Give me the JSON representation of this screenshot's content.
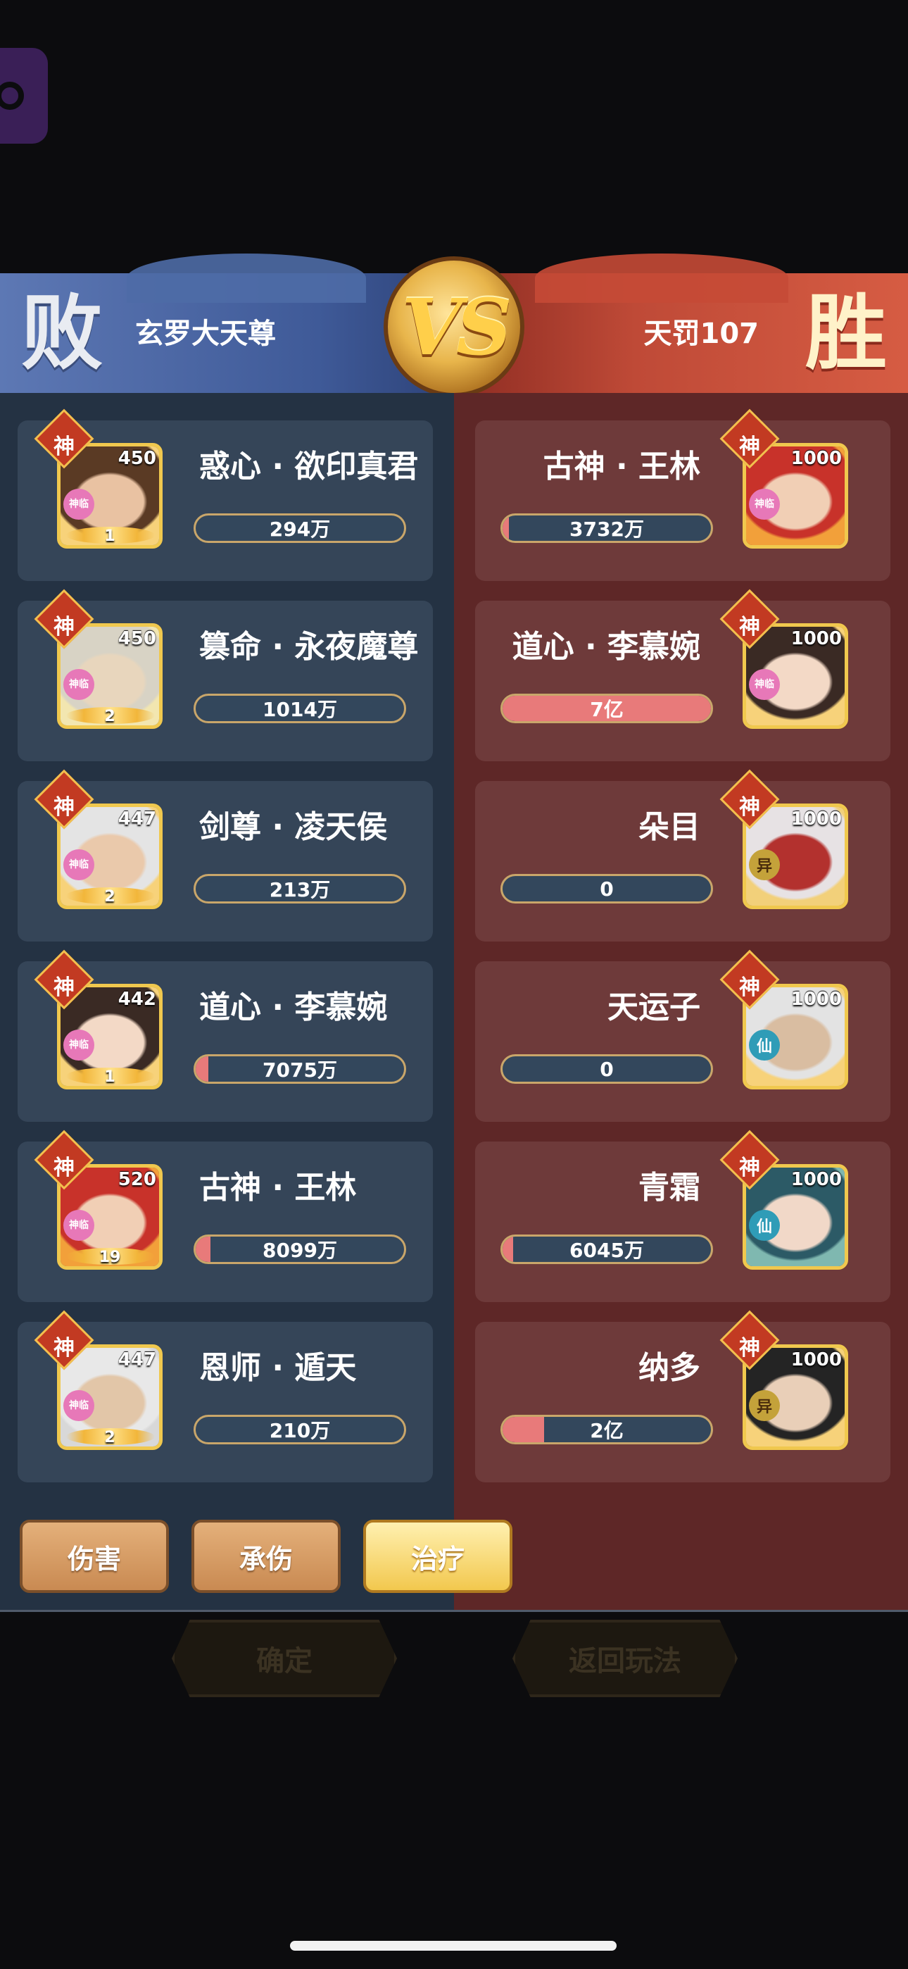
{
  "header": {
    "left": {
      "result": "败",
      "player": "玄罗大天尊"
    },
    "right": {
      "result": "胜",
      "player": "天罚107"
    },
    "vs": "VS"
  },
  "left_team": [
    {
      "badge": "神",
      "sub": "神临",
      "level": "450",
      "stars": "1",
      "name": "惑心 · 欲印真君",
      "value": "294万",
      "fill": 0.0,
      "portrait": "brown-hair-warrior"
    },
    {
      "badge": "神",
      "sub": "神临",
      "level": "450",
      "stars": "2",
      "name": "篡命 · 永夜魔尊",
      "value": "1014万",
      "fill": 0.0,
      "portrait": "silver-demon-lord"
    },
    {
      "badge": "神",
      "sub": "神临",
      "level": "447",
      "stars": "2",
      "name": "剑尊 · 凌天侯",
      "value": "213万",
      "fill": 0.0,
      "portrait": "white-beard-elder"
    },
    {
      "badge": "神",
      "sub": "神临",
      "level": "442",
      "stars": "1",
      "name": "道心 · 李慕婉",
      "value": "7075万",
      "fill": 0.06,
      "portrait": "dark-hair-maiden"
    },
    {
      "badge": "神",
      "sub": "神临",
      "level": "520",
      "stars": "19",
      "name": "古神 · 王林",
      "value": "8099万",
      "fill": 0.07,
      "portrait": "red-hair-god"
    },
    {
      "badge": "神",
      "sub": "神临",
      "level": "447",
      "stars": "2",
      "name": "恩师 · 遁天",
      "value": "210万",
      "fill": 0.0,
      "portrait": "old-master"
    }
  ],
  "right_team": [
    {
      "badge": "神",
      "sub": "神临",
      "level": "1000",
      "name": "古神 · 王林",
      "value": "3732万",
      "fill": 0.03,
      "portrait": "red-hair-god"
    },
    {
      "badge": "神",
      "sub": "神临",
      "level": "1000",
      "name": "道心 · 李慕婉",
      "value": "7亿",
      "fill": 1.0,
      "portrait": "dark-hair-maiden"
    },
    {
      "badge": "神",
      "sub": "异",
      "level": "1000",
      "name": "朵目",
      "value": "0",
      "fill": 0.0,
      "portrait": "masked-warrior"
    },
    {
      "badge": "神",
      "sub": "仙",
      "level": "1000",
      "name": "天运子",
      "value": "0",
      "fill": 0.0,
      "portrait": "white-beard-sage"
    },
    {
      "badge": "神",
      "sub": "仙",
      "level": "1000",
      "name": "青霜",
      "value": "6045万",
      "fill": 0.05,
      "portrait": "teal-hair-fairy"
    },
    {
      "badge": "神",
      "sub": "异",
      "level": "1000",
      "name": "纳多",
      "value": "2亿",
      "fill": 0.2,
      "portrait": "black-hair-youth"
    }
  ],
  "tabs": [
    {
      "label": "伤害",
      "active": false
    },
    {
      "label": "承伤",
      "active": false
    },
    {
      "label": "治疗",
      "active": true
    }
  ],
  "actions": {
    "confirm": "确定",
    "back": "返回玩法"
  },
  "colors": {
    "left_panel": "#243243",
    "right_panel": "#5e2727",
    "bar_fill": "#e87a7a",
    "gold": "#f0c84e"
  }
}
